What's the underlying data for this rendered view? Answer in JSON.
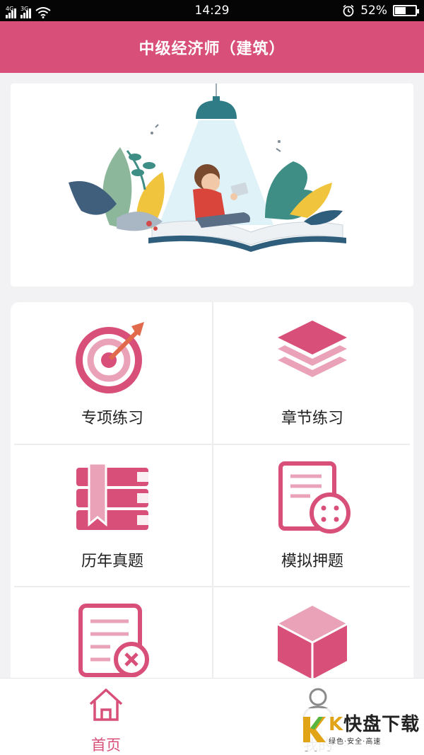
{
  "status_bar": {
    "signal_1_label": "4G",
    "signal_2_label": "3G",
    "time": "14:29",
    "battery_text": "52%",
    "battery_level_percent": 52
  },
  "header": {
    "title": "中级经济师（建筑）"
  },
  "menu": {
    "items": [
      {
        "label": "专项练习",
        "icon": "target-arrow-icon"
      },
      {
        "label": "章节练习",
        "icon": "layers-icon"
      },
      {
        "label": "历年真题",
        "icon": "books-icon"
      },
      {
        "label": "模拟押题",
        "icon": "document-target-icon"
      },
      {
        "label": "",
        "icon": "document-x-icon"
      },
      {
        "label": "",
        "icon": "cube-icon"
      }
    ]
  },
  "tabs": [
    {
      "label": "首页",
      "icon": "home-icon",
      "active": true
    },
    {
      "label": "我的",
      "icon": "user-icon",
      "active": false
    }
  ],
  "watermark": {
    "brand_k": "K",
    "brand_main": "快盘下载",
    "tagline": "绿色·安全·高速"
  },
  "colors": {
    "accent": "#d8507a",
    "accent_light": "#eaa2b9",
    "inactive": "#8a8a8a"
  }
}
